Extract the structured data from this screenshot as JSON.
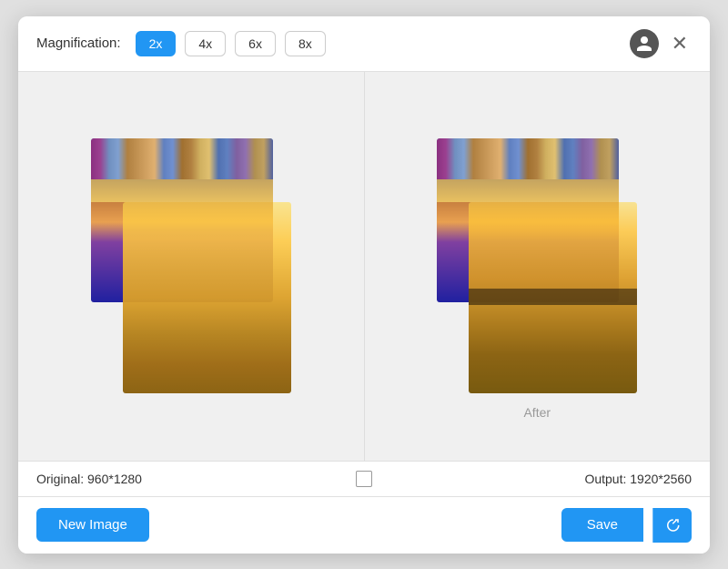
{
  "header": {
    "magnification_label": "Magnification:",
    "buttons": [
      {
        "label": "2x",
        "active": true
      },
      {
        "label": "4x",
        "active": false
      },
      {
        "label": "6x",
        "active": false
      },
      {
        "label": "8x",
        "active": false
      }
    ]
  },
  "image_area": {
    "after_label": "After",
    "original_info": "Original: 960*1280",
    "output_info": "Output: 1920*2560"
  },
  "footer": {
    "new_image_label": "New Image",
    "save_label": "Save"
  }
}
